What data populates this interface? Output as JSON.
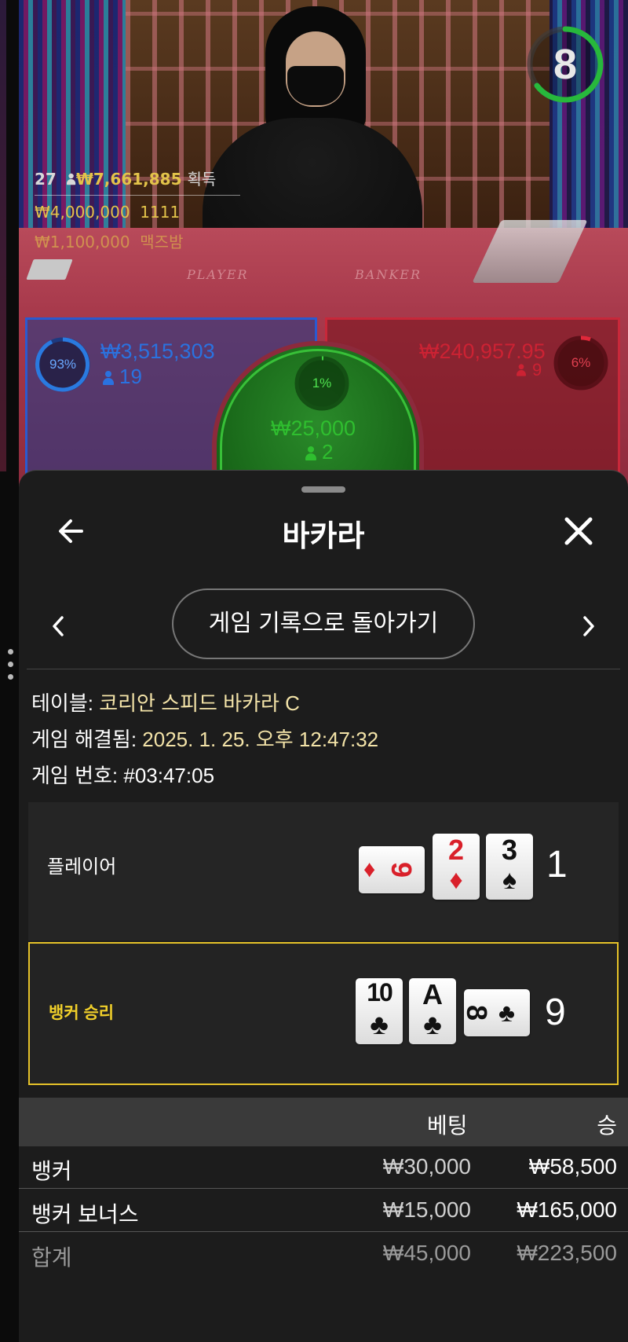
{
  "stream": {
    "timer": "8",
    "players_count": "27",
    "total_won": "₩7,661,885",
    "total_won_label": "획득",
    "top_bet_1_amount": "₩4,000,000",
    "top_bet_1_user": "1111",
    "top_bet_2_amount": "₩1,100,000",
    "top_bet_2_user": "맥즈밤",
    "felt_player": "PLAYER",
    "felt_banker": "BANKER",
    "player_area": {
      "percent": "93%",
      "amount": "₩3,515,303",
      "players": "19",
      "color": "#2a6ad8"
    },
    "banker_area": {
      "percent": "6%",
      "amount": "₩240,957.95",
      "players": "9",
      "color": "#d8283a"
    },
    "tie_area": {
      "percent": "1%",
      "amount": "₩25,000",
      "players": "2",
      "color": "#2fbf2f"
    }
  },
  "sheet": {
    "title": "바카라",
    "back_icon": "arrow-left-icon",
    "close_icon": "close-icon",
    "history_button": "게임 기록으로 돌아가기",
    "table_label": "테이블: ",
    "table_value": "코리안 스피드 바카라 C",
    "resolved_label": "게임 해결됨: ",
    "resolved_value": "2025. 1. 25. 오후 12:47:32",
    "game_number_label": "게임 번호: ",
    "game_number_value": "#03:47:05",
    "player": {
      "label": "플레이어",
      "score": "1",
      "cards": [
        {
          "rank": "9",
          "suit": "♦",
          "color": "red",
          "orientation": "side"
        },
        {
          "rank": "2",
          "suit": "♦",
          "color": "red",
          "orientation": "up"
        },
        {
          "rank": "3",
          "suit": "♠",
          "color": "black",
          "orientation": "up"
        }
      ]
    },
    "banker": {
      "label": "뱅커 승리",
      "score": "9",
      "cards": [
        {
          "rank": "10",
          "suit": "♣",
          "color": "black",
          "orientation": "up"
        },
        {
          "rank": "A",
          "suit": "♣",
          "color": "black",
          "orientation": "up"
        },
        {
          "rank": "8",
          "suit": "♣",
          "color": "black",
          "orientation": "side"
        }
      ]
    },
    "bets_table": {
      "headers": {
        "bet": "베팅",
        "win": "승"
      },
      "rows": [
        {
          "name": "뱅커",
          "bet": "₩30,000",
          "win": "₩58,500"
        },
        {
          "name": "뱅커 보너스",
          "bet": "₩15,000",
          "win": "₩165,000"
        }
      ],
      "total": {
        "name": "합계",
        "bet": "₩45,000",
        "win": "₩223,500"
      }
    },
    "accent_color": "#f0cf2a"
  }
}
